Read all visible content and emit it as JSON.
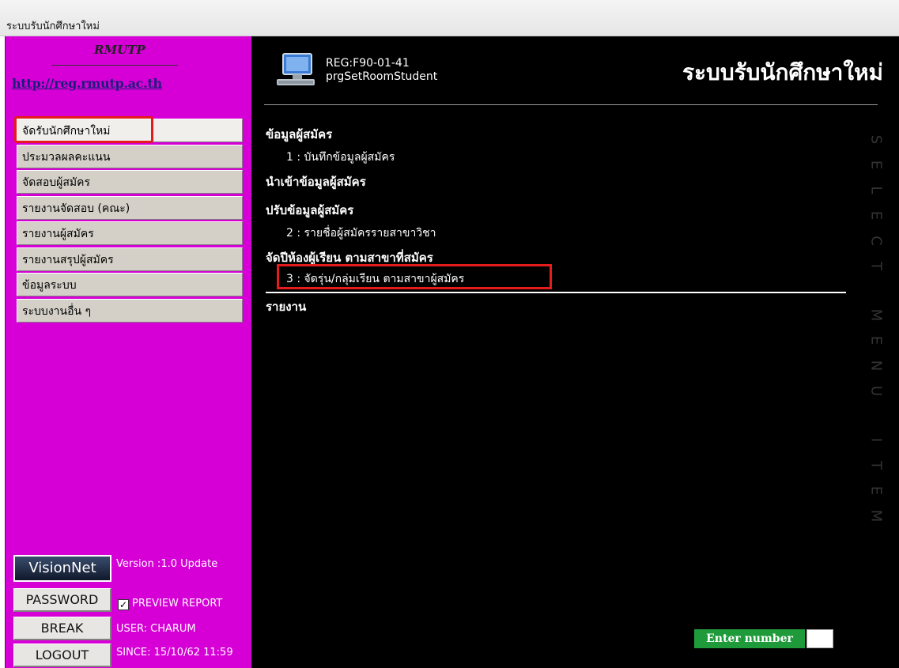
{
  "window": {
    "title": "ระบบรับนักศึกษาใหม่"
  },
  "sidebar": {
    "brand_name": "RMUTP",
    "brand_link": "http://reg.rmutp.ac.th",
    "items": [
      {
        "label": "จัดรับนักศึกษาใหม่",
        "active": true
      },
      {
        "label": "ประมวลผลคะแนน"
      },
      {
        "label": "จัดสอบผู้สมัคร"
      },
      {
        "label": "รายงานจัดสอบ (คณะ)"
      },
      {
        "label": "รายงานผู้สมัคร"
      },
      {
        "label": "รายงานสรุปผู้สมัคร"
      },
      {
        "label": "ข้อมูลระบบ"
      },
      {
        "label": "ระบบงานอื่น ๆ"
      }
    ],
    "visionnet_label": "VisionNet",
    "version": "Version :1.0 Update",
    "password_button": "PASSWORD",
    "preview_report": "PREVIEW REPORT",
    "preview_checked": true,
    "break_button": "BREAK",
    "user": "USER: CHARUM",
    "logout_button": "LOGOUT",
    "since": "SINCE: 15/10/62 11:59"
  },
  "main": {
    "program_code": "REG:F90-01-41",
    "program_name": "prgSetRoomStudent",
    "system_title": "ระบบรับนักศึกษาใหม่",
    "sections": [
      {
        "heading": "ข้อมูลผู้สมัคร",
        "items": [
          "1 : บันทึกข้อมูลผู้สมัคร"
        ]
      },
      {
        "heading": "นำเข้าข้อมูลผู้สมัคร",
        "items": []
      },
      {
        "heading": "ปรับข้อมูลผู้สมัคร",
        "items": [
          "2 : รายชื่อผู้สมัครรายสาขาวิชา"
        ]
      },
      {
        "heading": "จัดปีห้องผู้เรียน ตามสาขาที่สมัคร",
        "items": [
          "3 : จัดรุ่น/กลุ่มเรียน ตามสาขาผู้สมัคร"
        ]
      },
      {
        "heading": "รายงาน",
        "items": []
      }
    ],
    "vertical_text": [
      "S",
      "E",
      "L",
      "E",
      "C",
      "T",
      "M",
      "E",
      "N",
      "U",
      "I",
      "T",
      "E",
      "M"
    ],
    "enter_number_label": "Enter number",
    "enter_number_value": ""
  },
  "colors": {
    "sidebar_bg": "#d600d6",
    "main_bg": "#000000",
    "highlight": "#e61b1b",
    "enter_label_bg": "#1f9a3a"
  }
}
